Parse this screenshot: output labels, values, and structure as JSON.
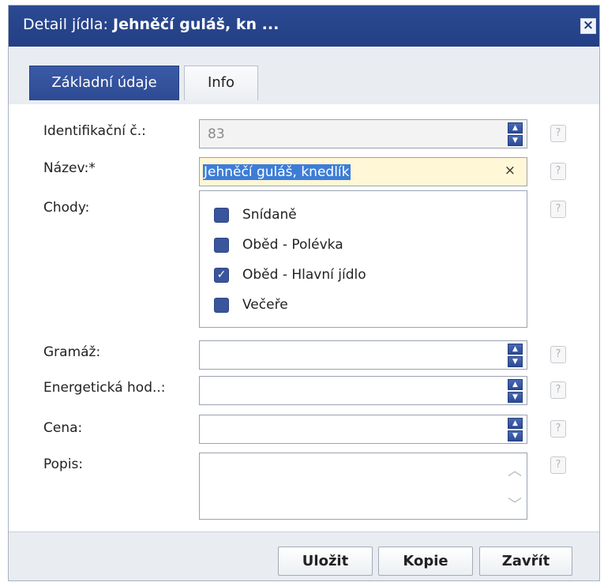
{
  "window": {
    "title_prefix": "Detail jídla: ",
    "title_bold": "Jehněčí guláš, kn ...",
    "close_icon": "close-icon",
    "close_glyph": "×"
  },
  "tabs": [
    {
      "label": "Základní údaje",
      "active": true
    },
    {
      "label": "Info",
      "active": false
    }
  ],
  "form": {
    "id_label": "Identifikační č.:",
    "id_value": "83",
    "name_label": "Název:*",
    "name_value": "Jehněčí guláš, knedlík",
    "clear_glyph": "×",
    "courses_label": "Chody:",
    "courses": [
      {
        "label": "Snídaně",
        "checked": false
      },
      {
        "label": "Oběd - Polévka",
        "checked": false
      },
      {
        "label": "Oběd - Hlavní jídlo",
        "checked": true
      },
      {
        "label": "Večeře",
        "checked": false
      }
    ],
    "weight_label": "Gramáž:",
    "weight_value": "",
    "energy_label": "Energetická hod..:",
    "energy_value": "",
    "price_label": "Cena:",
    "price_value": "",
    "description_label": "Popis:",
    "description_value": "",
    "help_glyph": "?",
    "check_glyph": "✓"
  },
  "buttons": {
    "save": "Uložit",
    "copy": "Kopie",
    "close": "Zavřít"
  },
  "colors": {
    "accent": "#2c4a95",
    "highlight": "#fff7d6",
    "selection": "#3d7dd8"
  }
}
